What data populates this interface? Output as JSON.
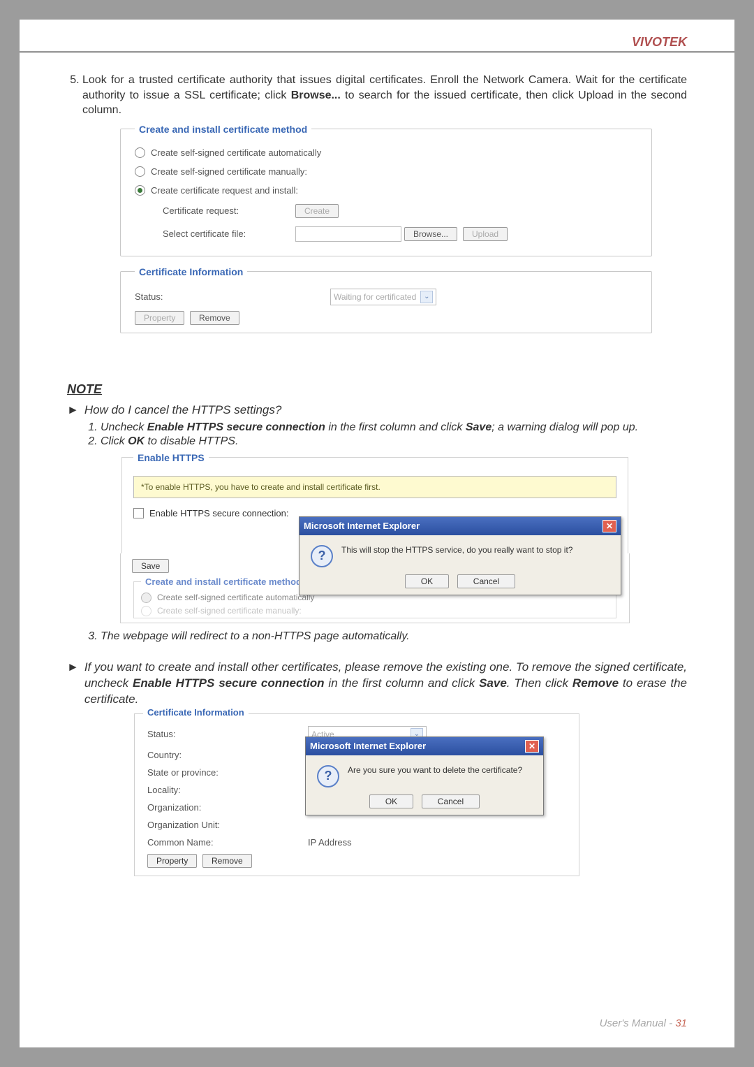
{
  "brand": "VIVOTEK",
  "step5": "Look for a trusted certificate authority that issues digital certificates. Enroll the Network Camera. Wait for the certificate authority to issue a SSL certificate; click ",
  "step5_b1": "Browse...",
  "step5_b2": " to search for the issued certificate, then click Upload in the second column.",
  "fs1": {
    "legend": "Create and install certificate method",
    "opt1": "Create self-signed certificate automatically",
    "opt2": "Create self-signed certificate manually:",
    "opt3": "Create certificate request and install:",
    "cert_req_label": "Certificate request:",
    "create_btn": "Create",
    "select_file_label": "Select certificate file:",
    "browse_btn": "Browse...",
    "upload_btn": "Upload"
  },
  "fs2": {
    "legend": "Certificate Information",
    "status_label": "Status:",
    "status_value": "Waiting for certificated",
    "property_btn": "Property",
    "remove_btn": "Remove"
  },
  "note": "NOTE",
  "q1": "How do I cancel the HTTPS settings?",
  "q1_s1a": "Uncheck ",
  "q1_s1b": "Enable HTTPS secure connection",
  "q1_s1c": " in the first column and click ",
  "q1_s1d": "Save",
  "q1_s1e": "; a warning dialog will pop up.",
  "q1_s2a": "Click ",
  "q1_s2b": "OK",
  "q1_s2c": " to disable HTTPS.",
  "sc1": {
    "legend": "Enable HTTPS",
    "notice": "*To enable HTTPS, you have to create and install certificate first.",
    "enable_label": "Enable HTTPS secure connection:",
    "save_btn": "Save",
    "method_legend": "Create and install certificate method",
    "opt1": "Create self-signed certificate automatically",
    "opt2": "Create self-signed certificate manually:"
  },
  "dlg1": {
    "title": "Microsoft Internet Explorer",
    "msg": "This will stop the HTTPS service, do you really want to stop it?",
    "ok": "OK",
    "cancel": "Cancel"
  },
  "q1_s3": "The webpage will redirect to a non-HTTPS page automatically.",
  "q2a": "If you want to create and install other certificates, please remove the existing one. To remove the signed certificate, uncheck ",
  "q2b": "Enable HTTPS secure connection",
  "q2c": " in the first column and click ",
  "q2d": "Save",
  "q2e": ". Then click ",
  "q2f": "Remove",
  "q2g": " to erase the certificate.",
  "ci": {
    "legend": "Certificate Information",
    "status_l": "Status:",
    "status_v": "Active",
    "country_l": "Country:",
    "state_l": "State or province:",
    "locality_l": "Locality:",
    "org_l": "Organization:",
    "orgunit_l": "Organization Unit:",
    "cn_l": "Common Name:",
    "cn_v": "IP Address",
    "property_btn": "Property",
    "remove_btn": "Remove"
  },
  "dlg2": {
    "title": "Microsoft Internet Explorer",
    "msg": "Are you sure you want to delete the certificate?",
    "ok": "OK",
    "cancel": "Cancel"
  },
  "footer_a": "User's Manual - ",
  "footer_b": "31"
}
